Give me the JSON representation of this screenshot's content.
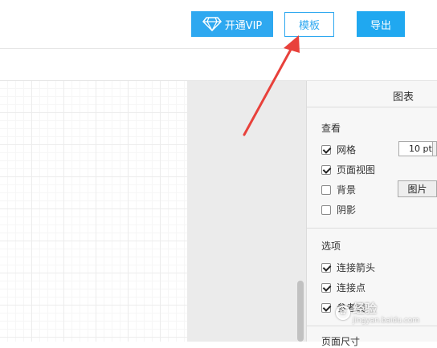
{
  "header": {
    "vip_label": "开通VIP",
    "template_label": "模板",
    "export_label": "导出"
  },
  "panel": {
    "title": "图表",
    "view_section": "查看",
    "view_items": [
      {
        "label": "网格",
        "checked": true
      },
      {
        "label": "页面视图",
        "checked": true
      },
      {
        "label": "背景",
        "checked": false
      },
      {
        "label": "阴影",
        "checked": false
      }
    ],
    "grid_size_value": "10 pt",
    "background_image_button": "图片",
    "options_section": "选项",
    "option_items": [
      {
        "label": "连接箭头",
        "checked": true
      },
      {
        "label": "连接点",
        "checked": true
      },
      {
        "label": "参考线",
        "checked": true
      }
    ],
    "page_size_section": "页面尺寸"
  },
  "watermark": {
    "text": "经验",
    "sub": "jingyan.baidu.com"
  },
  "colors": {
    "accent": "#2ea8f0",
    "arrow": "#e8413b"
  },
  "icons": {
    "vip": "diamond-icon"
  }
}
